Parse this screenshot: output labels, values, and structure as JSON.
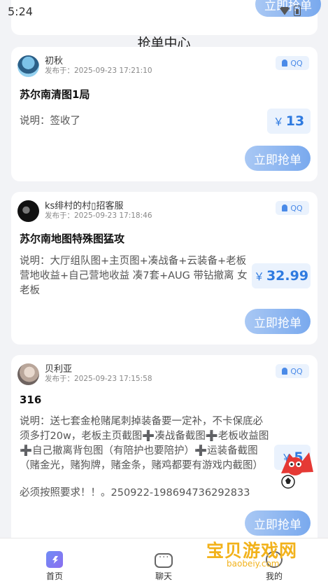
{
  "status_bar": {
    "time": "5:24"
  },
  "previous_card": {
    "grab_label": "立即抢单"
  },
  "page": {
    "title": "抢单中心"
  },
  "orders": [
    {
      "username": "初秋",
      "posted_at": "发布于：2025-09-23 17:21:10",
      "contact": "QQ",
      "title": "苏尔南清图1局",
      "description": "说明：签收了",
      "price_currency": "￥",
      "price": "13",
      "grab_label": "立即抢单"
    },
    {
      "username": "ks绯村的村▯招客服",
      "posted_at": "发布于：2025-09-23 17:18:46",
      "contact": "QQ",
      "title": "苏尔南地图特殊图猛攻",
      "description": "说明：大厅组队图+主页图+凑战备+云装备+老板营地收益+自己营地收益 凑7套+AUG 带钻撤离 女老板",
      "price_currency": "￥",
      "price": "32.99",
      "grab_label": "立即抢单"
    },
    {
      "username": "贝利亚",
      "posted_at": "发布于：2025-09-23 17:15:58",
      "contact": "QQ",
      "title": "316",
      "description": "说明：送七套金枪赌尾刺掉装备要一定补，不卡保底必须多打20w，老板主页截图➕凑战备截图➕老板收益图➕自己撤离背包图（有陪护也要陪护）➕运装备截图（赌金光，赌狗牌，赌金条，赌鸡都要有游戏内截图）",
      "description_extra": "必须按照要求！！。250922-198694736292833",
      "price_currency": "￥",
      "price": "5",
      "grab_label": "立即抢单"
    }
  ],
  "tab_bar": {
    "items": [
      {
        "label": "首页",
        "icon": "home-icon"
      },
      {
        "label": "聊天",
        "icon": "chat-icon"
      },
      {
        "label": "我的",
        "icon": "mine-icon"
      }
    ]
  },
  "watermark": {
    "text": "宝贝游戏网",
    "url": "baobeiy.com"
  },
  "colors": {
    "accent": "#2e7ae0",
    "button_start": "#a9c8f4",
    "button_end": "#79a9ee",
    "background": "#f2f3f6"
  }
}
